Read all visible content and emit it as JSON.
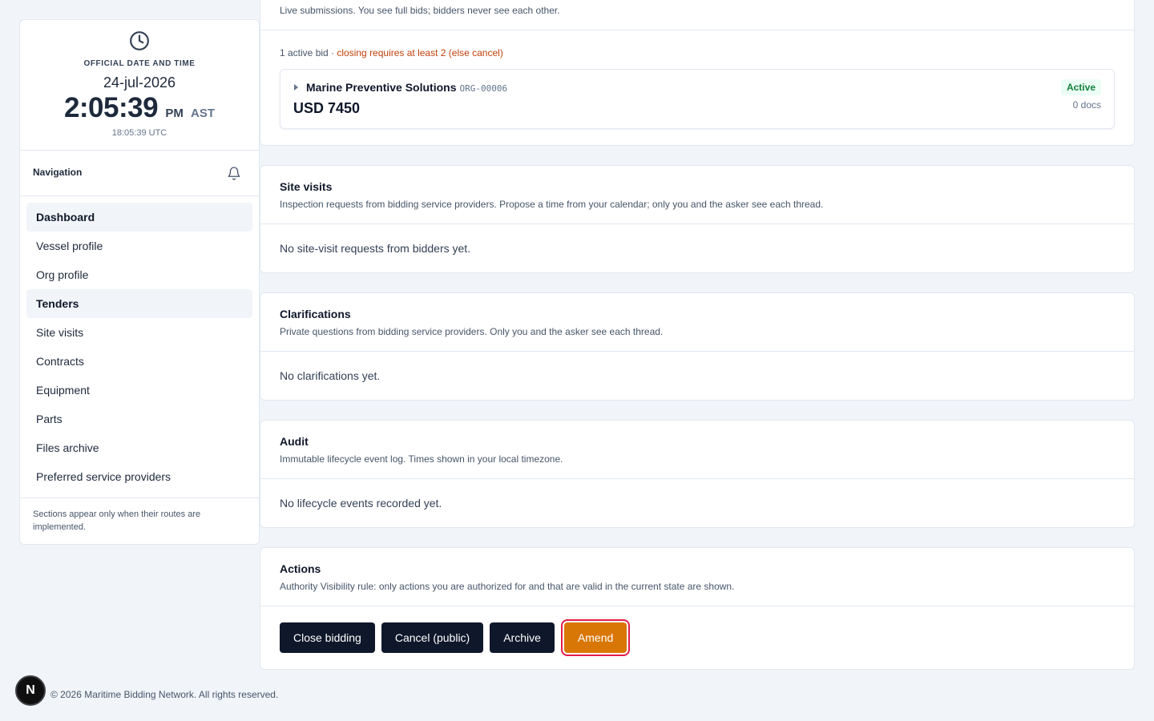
{
  "clock": {
    "caption": "OFFICIAL DATE AND TIME",
    "date": "24-jul-2026",
    "time": "2:05:39",
    "ampm": "PM",
    "timezone": "AST",
    "utc": "18:05:39 UTC"
  },
  "nav": {
    "title": "Navigation",
    "items": [
      {
        "label": "Dashboard"
      },
      {
        "label": "Vessel profile"
      },
      {
        "label": "Org profile"
      },
      {
        "label": "Tenders"
      },
      {
        "label": "Site visits"
      },
      {
        "label": "Contracts"
      },
      {
        "label": "Equipment"
      },
      {
        "label": "Parts"
      },
      {
        "label": "Files archive"
      },
      {
        "label": "Preferred service providers"
      }
    ],
    "note": "Sections appear only when their routes are implemented."
  },
  "bids": {
    "subtitle": "Live submissions. You see full bids; bidders never see each other.",
    "count_text": "1 active bid · ",
    "warning": "closing requires at least 2 (else cancel)",
    "items": [
      {
        "org_name": "Marine Preventive Solutions",
        "org_id": "ORG-00006",
        "amount": "USD 7450",
        "status": "Active",
        "docs": "0 docs"
      }
    ]
  },
  "site_visits": {
    "title": "Site visits",
    "description": "Inspection requests from bidding service providers. Propose a time from your calendar; only you and the asker see each thread.",
    "empty": "No site-visit requests from bidders yet."
  },
  "clarifications": {
    "title": "Clarifications",
    "description": "Private questions from bidding service providers. Only you and the asker see each thread.",
    "empty": "No clarifications yet."
  },
  "audit": {
    "title": "Audit",
    "description": "Immutable lifecycle event log. Times shown in your local timezone.",
    "empty": "No lifecycle events recorded yet."
  },
  "actions": {
    "title": "Actions",
    "description": "Authority Visibility rule: only actions you are authorized for and that are valid in the current state are shown.",
    "buttons": {
      "close_bidding": "Close bidding",
      "cancel_public": "Cancel (public)",
      "archive": "Archive",
      "amend": "Amend"
    }
  },
  "footer": {
    "text": "© 2026 Maritime Bidding Network. All rights reserved.",
    "badge": "N"
  },
  "colors": {
    "primary_button": "#0f172a",
    "amend_button": "#d97706",
    "focus_ring": "#e11d48",
    "warning_text": "#c2410c",
    "status_active": "#15803d"
  },
  "icons": {
    "clock": "clock-icon",
    "bell": "bell-icon",
    "caret": "caret-right-icon"
  }
}
